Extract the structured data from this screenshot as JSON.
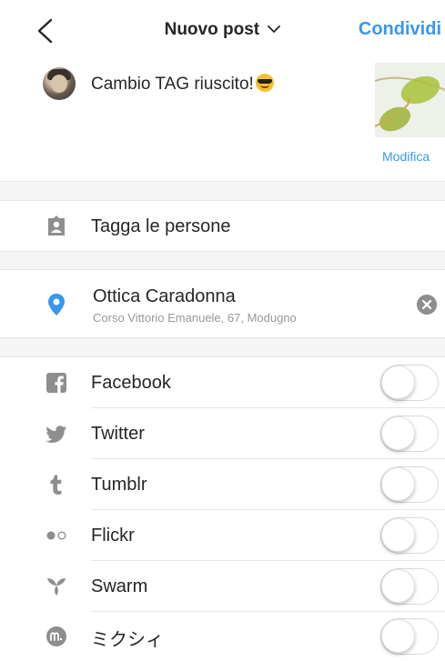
{
  "header": {
    "title": "Nuovo post",
    "share_label": "Condividi"
  },
  "composer": {
    "caption": "Cambio TAG riuscito!",
    "edit_label": "Modifica"
  },
  "tag_people": {
    "label": "Tagga le persone"
  },
  "location": {
    "name": "Ottica Caradonna",
    "address": "Corso Vittorio Emanuele, 67, Modugno"
  },
  "share_targets": [
    {
      "label": "Facebook",
      "icon": "facebook-icon",
      "enabled": false
    },
    {
      "label": "Twitter",
      "icon": "twitter-icon",
      "enabled": false
    },
    {
      "label": "Tumblr",
      "icon": "tumblr-icon",
      "enabled": false
    },
    {
      "label": "Flickr",
      "icon": "flickr-icon",
      "enabled": false
    },
    {
      "label": "Swarm",
      "icon": "swarm-icon",
      "enabled": false
    },
    {
      "label": "ミクシィ",
      "icon": "mixi-icon",
      "enabled": false
    }
  ],
  "colors": {
    "accent": "#3897f0",
    "text": "#262626",
    "icon_gray": "#8e8e8e"
  }
}
